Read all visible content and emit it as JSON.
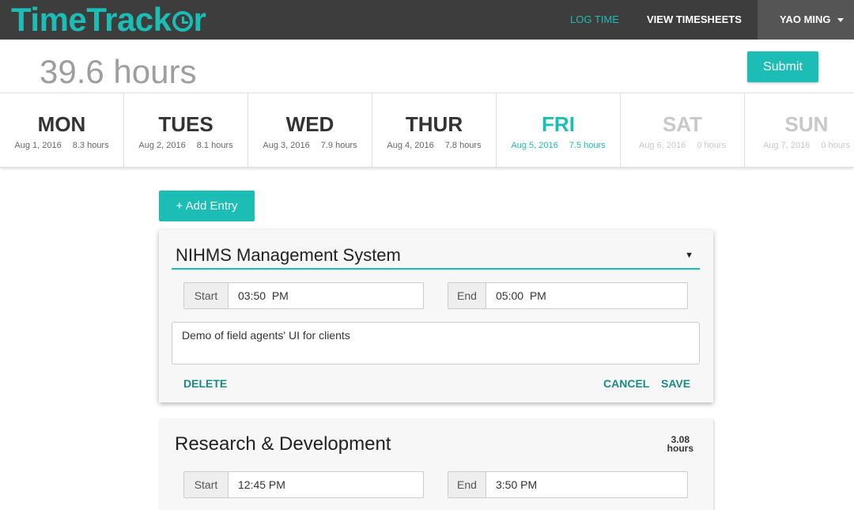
{
  "app": {
    "logo": "TimeTracker",
    "logo_pre": "TimeTrack",
    "logo_post": "r"
  },
  "nav": {
    "log_time": "LOG TIME",
    "view_timesheets": "VIEW TIMESHEETS",
    "user": "YAO MING"
  },
  "header": {
    "total": "39.6 hours",
    "submit": "Submit"
  },
  "days": [
    {
      "name": "MON",
      "date": "Aug 1, 2016",
      "hours": "8.3 hours",
      "state": "normal"
    },
    {
      "name": "TUES",
      "date": "Aug 2, 2016",
      "hours": "8.1 hours",
      "state": "normal"
    },
    {
      "name": "WED",
      "date": "Aug 3, 2016",
      "hours": "7.9 hours",
      "state": "normal"
    },
    {
      "name": "THUR",
      "date": "Aug 4, 2016",
      "hours": "7.8 hours",
      "state": "normal"
    },
    {
      "name": "FRI",
      "date": "Aug 5, 2016",
      "hours": "7.5 hours",
      "state": "active"
    },
    {
      "name": "SAT",
      "date": "Aug 6, 2016",
      "hours": "0 hours",
      "state": "weekend"
    },
    {
      "name": "SUN",
      "date": "Aug 7, 2016",
      "hours": "0 hours",
      "state": "weekend"
    }
  ],
  "add_entry": "+ Add Entry",
  "editing_entry": {
    "project": "NIHMS Management System",
    "start_label": "Start",
    "start_value": "03:50  PM",
    "end_label": "End",
    "end_value": "05:00  PM",
    "notes": "Demo of field agents' UI for clients",
    "delete": "DELETE",
    "cancel": "CANCEL",
    "save": "SAVE"
  },
  "entries": [
    {
      "project": "Research & Development",
      "duration_value": "3.08",
      "duration_unit": "hours",
      "start_label": "Start",
      "start_value": "12:45 PM",
      "end_label": "End",
      "end_value": "3:50 PM"
    }
  ],
  "colors": {
    "accent": "#1bbdb4",
    "topbar": "#3d3d3d",
    "weekend": "#c8c8c8"
  }
}
